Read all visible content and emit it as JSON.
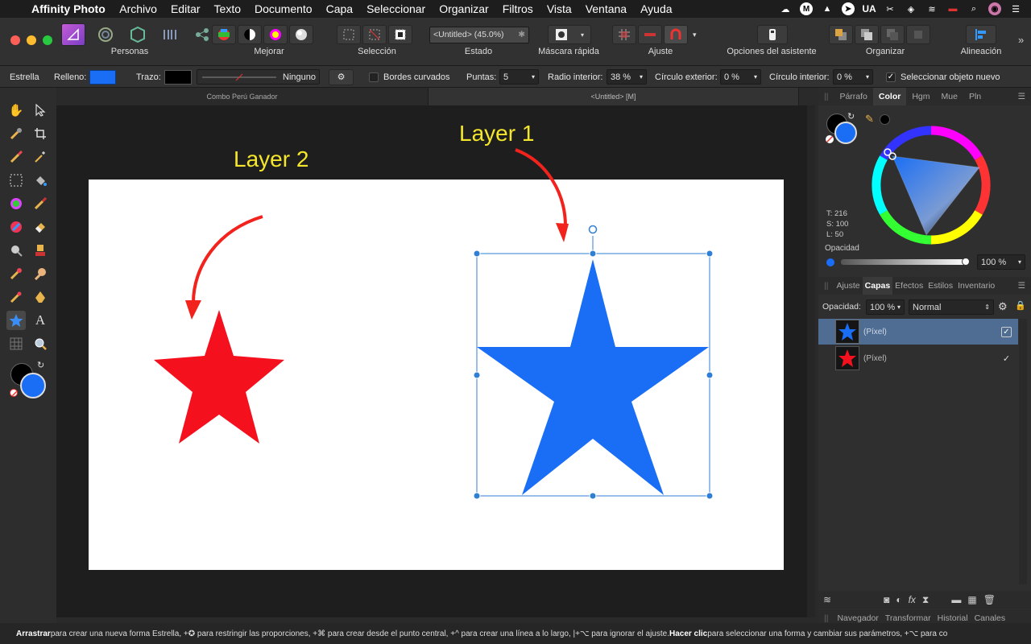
{
  "menubar": {
    "app_name": "Affinity Photo",
    "items": [
      "Archivo",
      "Editar",
      "Texto",
      "Documento",
      "Capa",
      "Seleccionar",
      "Organizar",
      "Filtros",
      "Vista",
      "Ventana",
      "Ayuda"
    ],
    "status_lang": "UA"
  },
  "toolbar": {
    "personas_label": "Personas",
    "mejorar_label": "Mejorar",
    "seleccion_label": "Selección",
    "estado_label": "Estado",
    "estado_value": "<Untitled> (45.0%)",
    "mascara_label": "Máscara rápida",
    "ajuste_label": "Ajuste",
    "asistente_label": "Opciones del asistente",
    "organizar_label": "Organizar",
    "alineacion_label": "Alineación"
  },
  "context": {
    "tool_name": "Estrella",
    "fill_label": "Relleno:",
    "stroke_label": "Trazo:",
    "stroke_style": "Ninguno",
    "curved_edges_label": "Bordes curvados",
    "points_label": "Puntas:",
    "points_value": "5",
    "inner_radius_label": "Radio interior:",
    "inner_radius_value": "38 %",
    "outer_circle_label": "Círculo exterior:",
    "outer_circle_value": "0 %",
    "inner_circle_label": "Círculo interior:",
    "inner_circle_value": "0 %",
    "select_new_label": "Seleccionar objeto nuevo"
  },
  "tabs": [
    "Combo Perú Ganador",
    "<Untitled> [M]"
  ],
  "annotations": {
    "layer1": "Layer 1",
    "layer2": "Layer 2"
  },
  "color_panel": {
    "tabs": [
      "Párrafo",
      "Color",
      "Hgm",
      "Mue",
      "Pln"
    ],
    "active": "Color",
    "t": "T: 216",
    "s": "S: 100",
    "l": "L: 50",
    "opacity_label": "Opacidad",
    "opacity_value": "100 %"
  },
  "layers_panel": {
    "tabs": [
      "Ajuste",
      "Capas",
      "Efectos",
      "Estilos",
      "Inventario"
    ],
    "active": "Capas",
    "opacity_label": "Opacidad:",
    "opacity_value": "100 %",
    "blend_mode": "Normal",
    "layers": [
      {
        "name": "(Píxel)",
        "color": "#1a6ef5",
        "selected": true
      },
      {
        "name": "(Píxel)",
        "color": "#f5101e",
        "selected": false
      }
    ]
  },
  "bottom_tabs": [
    "Navegador",
    "Transformar",
    "Historial",
    "Canales"
  ],
  "status": {
    "b1": "Arrastrar",
    "t1": " para crear una nueva forma Estrella, +✪ para restringir las proporciones, +⌘ para crear desde el punto central, +^ para crear una línea a lo largo, |+⌥ para ignorar el ajuste. ",
    "b2": "Hacer clic",
    "t2": " para seleccionar una forma y cambiar sus parámetros, +⌥ para co"
  },
  "colors": {
    "blue_star": "#1a6ef5",
    "red_star": "#f5101e",
    "annotation_text": "#f4e62a",
    "arrow": "#f2231c",
    "selection": "#2f7fd6"
  }
}
